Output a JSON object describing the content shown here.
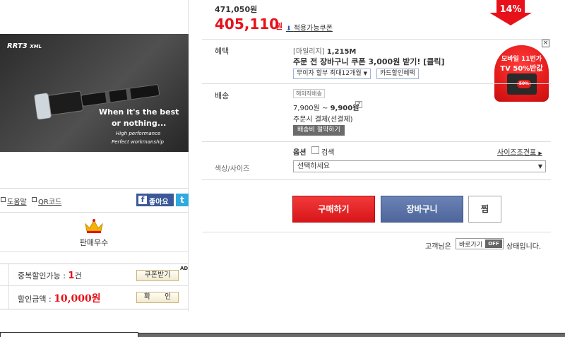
{
  "product": {
    "image_brand": "RRT3",
    "image_model": "XML",
    "image_slogan1": "When it's the best",
    "image_slogan2": "or nothing...",
    "image_line1": "High performance",
    "image_line2": "Perfect workmanship"
  },
  "tools": {
    "help": "도움말",
    "qrcode": "QR코드",
    "facebook_label": "좋아요",
    "facebook_icon": "f",
    "twitter_icon": "t"
  },
  "seller": {
    "grade_label": "판매우수"
  },
  "coupon": {
    "ad": "AD",
    "dup_label": "중복할인가능 : ",
    "dup_count": "1",
    "dup_unit": "건",
    "receive_button": "쿠폰받기",
    "discount_label": "할인금액 : ",
    "discount_amount": "10,000원",
    "confirm_button": "확　　인"
  },
  "price": {
    "original": "471,050원",
    "sale": "405,110",
    "sale_unit": "원",
    "coupon_link": "적용가능쿠폰",
    "discount_rate": "14%"
  },
  "benefit": {
    "label": "혜택",
    "mileage_label": "[마일리지]",
    "mileage_value": "1,215M",
    "cart_coupon": "주문 전 장바구니 쿠폰 3,000원 받기! [클릭]",
    "installment": "무이자 할부 최대12개월",
    "card_discount": "카드할인혜택"
  },
  "mobile_banner": {
    "line1": "모바일 11번가",
    "line2": "TV 50%반값",
    "badge": "50%",
    "close": "×"
  },
  "shipping": {
    "label": "배송",
    "overseas": "해외직배송",
    "fee_low": "7,900원 ~ ",
    "fee_high": "9,900원",
    "help": "?",
    "prepay": "주문시 결제(선결제)",
    "save_button": "배송비 절약하기"
  },
  "options": {
    "option_label": "옵션",
    "search_label": "검색",
    "size_chart": "사이즈조견표",
    "color_size_label": "색상/사이즈",
    "select_placeholder": "선택하세요"
  },
  "actions": {
    "buy": "구매하기",
    "cart": "장바구니",
    "wish": "찜"
  },
  "shortcut": {
    "prefix": "고객님은",
    "button": "바로가기",
    "state": "OFF",
    "suffix": "상태입니다."
  },
  "colors": {
    "price_red": "#e8111a",
    "buy_red": "#d8161a",
    "cart_blue": "#4e669b",
    "facebook": "#3b5998",
    "twitter": "#2fa9e0"
  }
}
